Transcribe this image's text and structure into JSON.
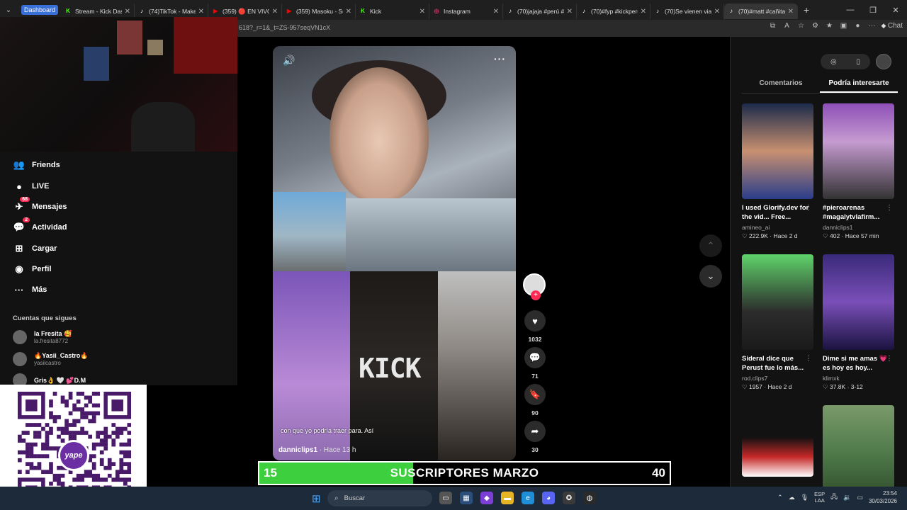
{
  "browser": {
    "group_label": "Dashboard",
    "tabs": [
      {
        "title": "Stream - Kick Dash",
        "icon": "kick-icon",
        "color": "#53fc18"
      },
      {
        "title": "(74)TikTok - Make",
        "icon": "tiktok-icon",
        "color": "#ffffff"
      },
      {
        "title": "(359) 🔴 EN VIVO",
        "icon": "youtube-icon",
        "color": "#ff0000"
      },
      {
        "title": "(359) Masoku - So",
        "icon": "youtube-icon",
        "color": "#ff0000"
      },
      {
        "title": "Kick",
        "icon": "kick-icon",
        "color": "#53fc18"
      },
      {
        "title": "Instagram",
        "icon": "instagram-icon",
        "color": "#e1306c"
      },
      {
        "title": "(70)jajaja #perú #p",
        "icon": "tiktok-icon",
        "color": "#ffffff"
      },
      {
        "title": "(70)#fyp #kickperu",
        "icon": "tiktok-icon",
        "color": "#ffffff"
      },
      {
        "title": "(70)Se vienen viaje",
        "icon": "tiktok-icon",
        "color": "#ffffff"
      },
      {
        "title": "(70)#matt #cañita",
        "icon": "tiktok-icon",
        "color": "#ffffff"
      }
    ],
    "url_fragment": "618?_r=1&_t=ZS-957seqVN1cX",
    "chat_label": "Chat"
  },
  "sidebar": {
    "nav": [
      {
        "label": "Friends",
        "icon": "friends-icon",
        "glyph": "👥",
        "badge": ""
      },
      {
        "label": "LIVE",
        "icon": "live-icon",
        "glyph": "●",
        "badge": ""
      },
      {
        "label": "Mensajes",
        "icon": "messages-icon",
        "glyph": "✈",
        "badge": "68"
      },
      {
        "label": "Actividad",
        "icon": "activity-icon",
        "glyph": "💬",
        "badge": "2"
      },
      {
        "label": "Cargar",
        "icon": "upload-icon",
        "glyph": "⊞",
        "badge": ""
      },
      {
        "label": "Perfil",
        "icon": "profile-icon",
        "glyph": "◉",
        "badge": ""
      },
      {
        "label": "Más",
        "icon": "more-icon",
        "glyph": "···",
        "badge": ""
      }
    ],
    "following_title": "Cuentas que sigues",
    "following": [
      {
        "name": "la Fresita 🥰",
        "handle": "la.fresita8772"
      },
      {
        "name": "🔥Yasii_Castro🔥",
        "handle": "yasiicastro"
      },
      {
        "name": "Gris👌 🤍 💕D.M",
        "handle": ""
      }
    ]
  },
  "qr": {
    "brand": "yape"
  },
  "video": {
    "caption": "con que yo podría traer para. Así",
    "author": "danniclips1",
    "time": "· Hace 13 h",
    "overlay_logo": "KICK",
    "likes": "1032",
    "comments": "71",
    "saves": "90",
    "shares": "30"
  },
  "right_panel": {
    "tabs": [
      "Comentarios",
      "Podría interesarte"
    ],
    "active_tab": 1,
    "cards": [
      {
        "title": "I used Glorify.dev for the vid... Free...",
        "author": "amineo_ai",
        "likes": "222.9K",
        "time": "Hace 2 d"
      },
      {
        "title": "#pieroarenas #magalytvlafirm...",
        "author": "danniclips1",
        "likes": "402",
        "time": "Hace 57 min"
      },
      {
        "title": "Sideral dice que Perust fue lo más...",
        "author": "rod.clips7",
        "likes": "1957",
        "time": "Hace 2 d"
      },
      {
        "title": "Dime si me amas 💗 es hoy es hoy...",
        "author": "klimxk",
        "likes": "37.8K",
        "time": "3-12"
      },
      {
        "title": "",
        "author": "",
        "likes": "",
        "time": ""
      },
      {
        "title": "",
        "author": "",
        "likes": "",
        "time": ""
      }
    ]
  },
  "subscribers": {
    "current": "15",
    "label": "SUSCRIPTORES MARZO",
    "goal": "40",
    "progress": 0.375,
    "fill_color": "#3ecf3e"
  },
  "taskbar": {
    "search_placeholder": "Buscar",
    "lang_top": "ESP",
    "lang_bottom": "LAA",
    "time": "23:54",
    "date": "30/03/2026"
  }
}
